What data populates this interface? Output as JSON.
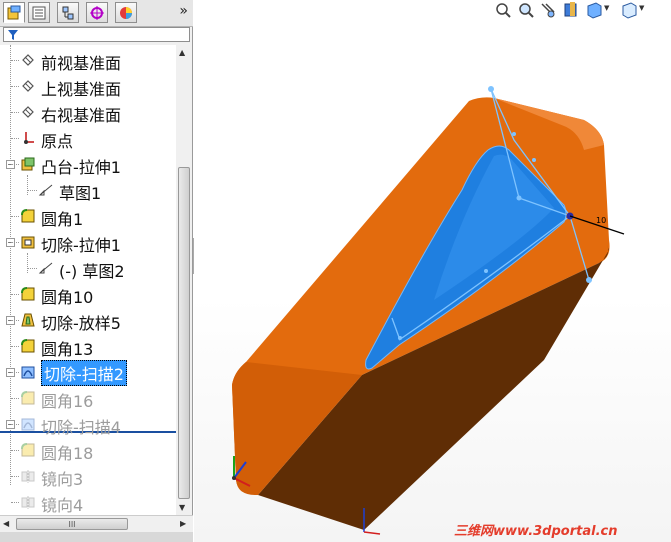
{
  "feature_tree": {
    "items": [
      {
        "label": "前视基准面",
        "icon": "plane-icon",
        "state": "normal"
      },
      {
        "label": "上视基准面",
        "icon": "plane-icon",
        "state": "normal"
      },
      {
        "label": "右视基准面",
        "icon": "plane-icon",
        "state": "normal"
      },
      {
        "label": "原点",
        "icon": "origin-icon",
        "state": "normal"
      },
      {
        "label": "凸台-拉伸1",
        "icon": "extrude-boss-icon",
        "state": "normal"
      },
      {
        "label": "草图1",
        "icon": "sketch-icon",
        "state": "normal"
      },
      {
        "label": "圆角1",
        "icon": "fillet-icon",
        "state": "normal"
      },
      {
        "label": "切除-拉伸1",
        "icon": "extrude-cut-icon",
        "state": "normal"
      },
      {
        "label": "(-) 草图2",
        "icon": "sketch-icon",
        "state": "normal"
      },
      {
        "label": "圆角10",
        "icon": "fillet-icon",
        "state": "normal"
      },
      {
        "label": "切除-放样5",
        "icon": "loft-cut-icon",
        "state": "normal"
      },
      {
        "label": "圆角13",
        "icon": "fillet-icon",
        "state": "normal"
      },
      {
        "label": "切除-扫描2",
        "icon": "sweep-cut-icon",
        "state": "selected"
      },
      {
        "label": "圆角16",
        "icon": "fillet-icon",
        "state": "suppressed"
      },
      {
        "label": "切除-扫描4",
        "icon": "sweep-cut-icon",
        "state": "suppressed"
      },
      {
        "label": "圆角18",
        "icon": "fillet-icon",
        "state": "suppressed"
      },
      {
        "label": "镜向3",
        "icon": "mirror-icon",
        "state": "suppressed"
      },
      {
        "label": "镜向4",
        "icon": "mirror-icon",
        "state": "suppressed"
      }
    ]
  },
  "panel_tabs": [
    "featuremanager-tab-icon",
    "propertymanager-tab-icon",
    "configurationmanager-tab-icon",
    "dimxpert-tab-icon",
    "display-manager-tab-icon"
  ],
  "view_toolbar": [
    "zoom-to-fit-icon",
    "zoom-area-icon",
    "previous-view-icon",
    "section-view-icon",
    "view-orientation-icon",
    "display-style-icon"
  ],
  "hscroll_label": "III",
  "expand_label": "»",
  "sketch_dimension": "10",
  "watermark": "三维网www.3dportal.cn",
  "colors": {
    "body_orange": "#e26a0c",
    "side_brown": "#5e2c05",
    "cut_blue": "#1f7fe0",
    "selection": "#3399ff"
  }
}
